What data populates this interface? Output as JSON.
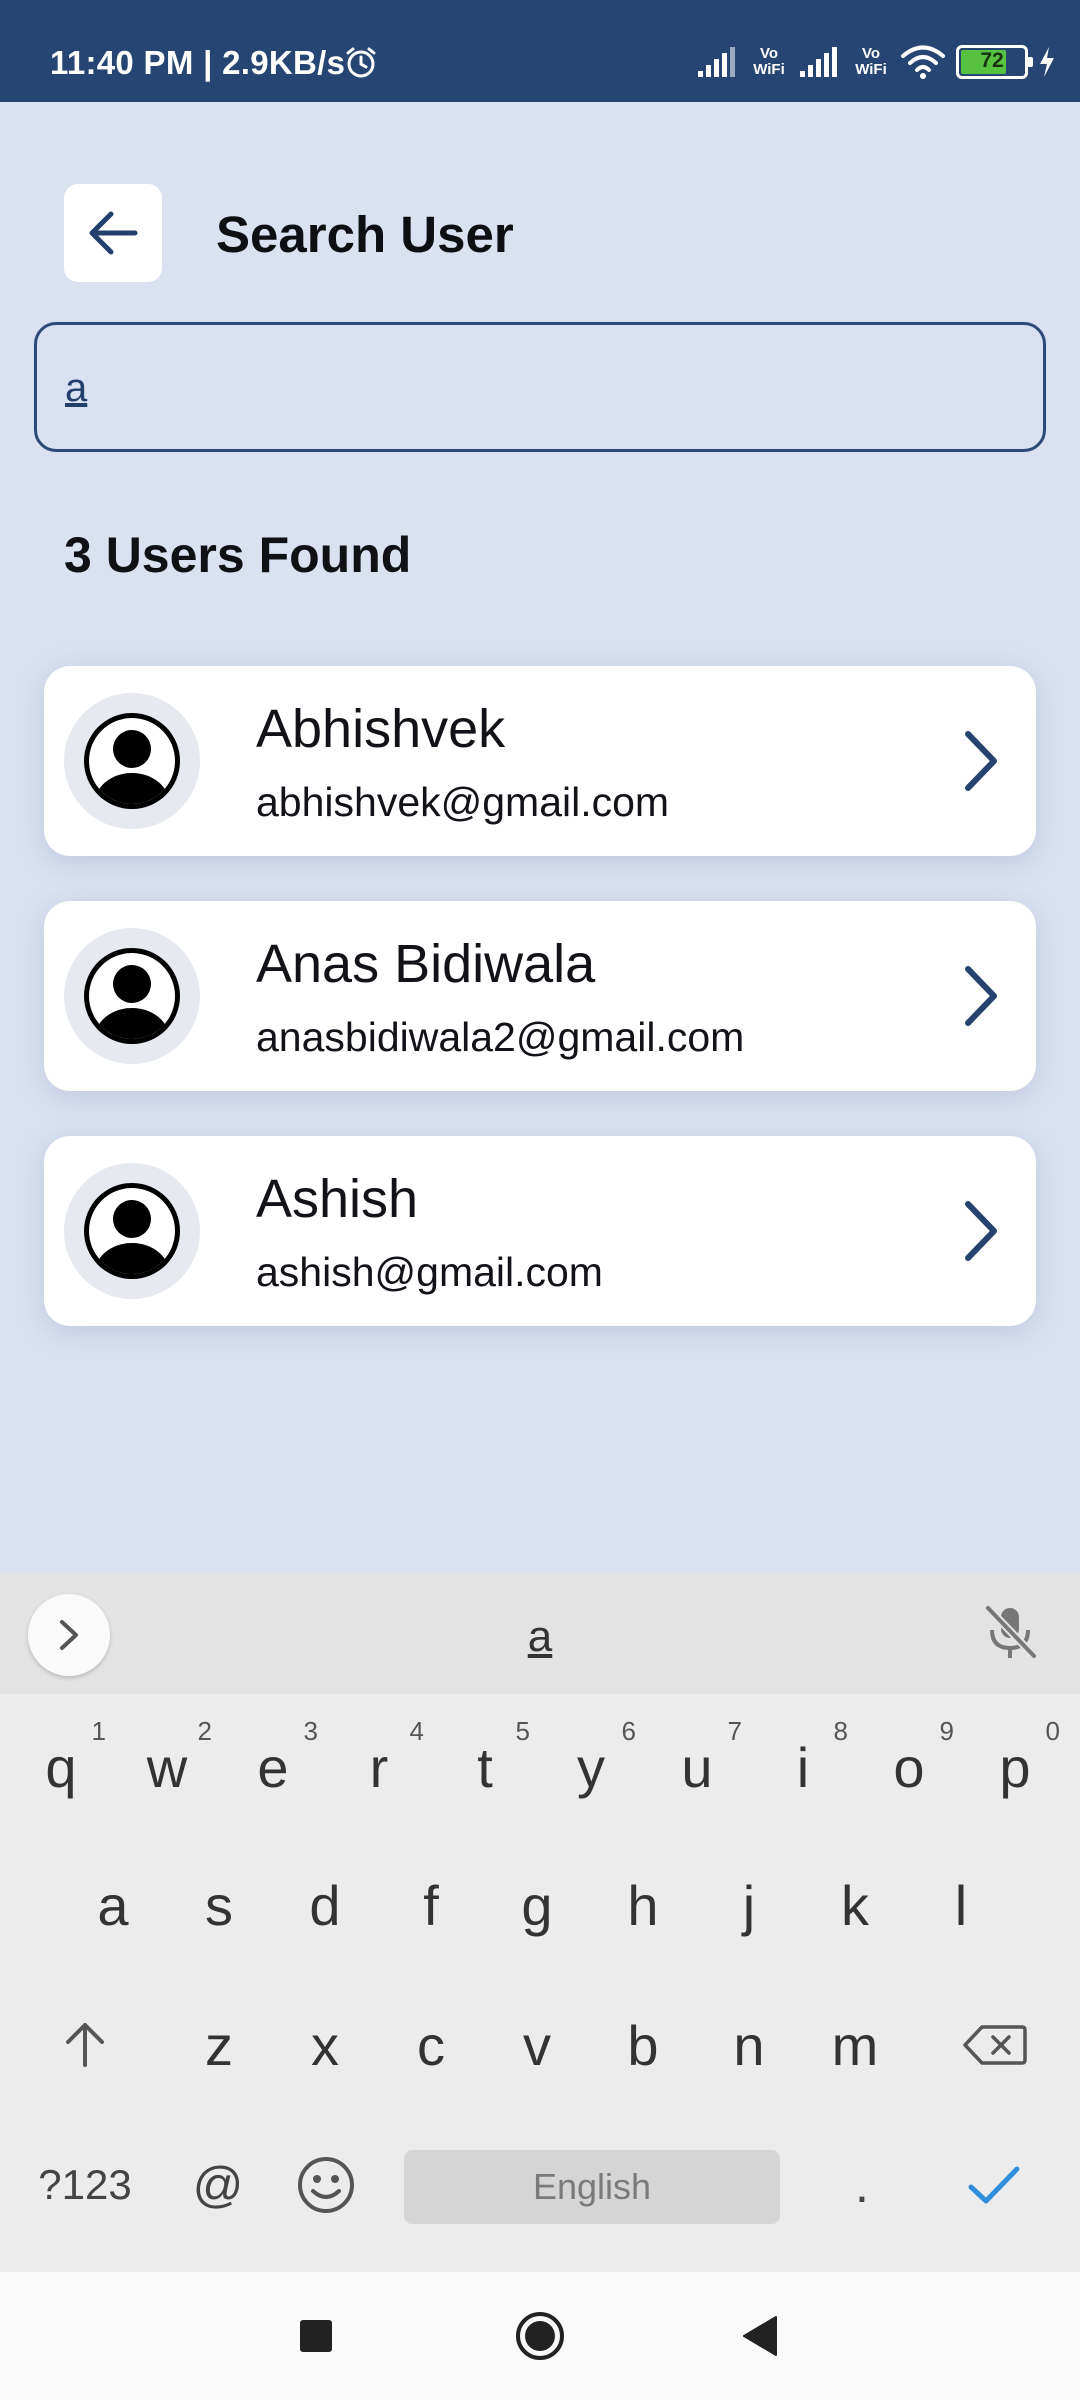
{
  "status_bar": {
    "time": "11:40 PM | 2.9KB/s",
    "battery": "72",
    "vowifi_label": "Vo\nWiFi",
    "battery_fraction": 0.72
  },
  "header": {
    "title": "Search User",
    "back_icon": "arrow-left-icon"
  },
  "search": {
    "value": "a",
    "placeholder": ""
  },
  "results": {
    "count_label": "3 Users Found",
    "users": [
      {
        "name": "Abhishvek",
        "email": "abhishvek@gmail.com"
      },
      {
        "name": "Anas Bidiwala",
        "email": "anasbidiwala2@gmail.com"
      },
      {
        "name": "Ashish",
        "email": "ashish@gmail.com"
      }
    ]
  },
  "keyboard": {
    "suggestion": "a",
    "row1": [
      {
        "k": "q",
        "n": "1"
      },
      {
        "k": "w",
        "n": "2"
      },
      {
        "k": "e",
        "n": "3"
      },
      {
        "k": "r",
        "n": "4"
      },
      {
        "k": "t",
        "n": "5"
      },
      {
        "k": "y",
        "n": "6"
      },
      {
        "k": "u",
        "n": "7"
      },
      {
        "k": "i",
        "n": "8"
      },
      {
        "k": "o",
        "n": "9"
      },
      {
        "k": "p",
        "n": "0"
      }
    ],
    "row2": [
      "a",
      "s",
      "d",
      "f",
      "g",
      "h",
      "j",
      "k",
      "l"
    ],
    "row3": [
      "z",
      "x",
      "c",
      "v",
      "b",
      "n",
      "m"
    ],
    "symbols_label": "?123",
    "at_label": "@",
    "space_label": "English",
    "period_label": "."
  },
  "colors": {
    "status_bar": "#274573",
    "background": "#dae2f2",
    "accent": "#2b4a78",
    "keyboard_check": "#2f8fdc"
  }
}
